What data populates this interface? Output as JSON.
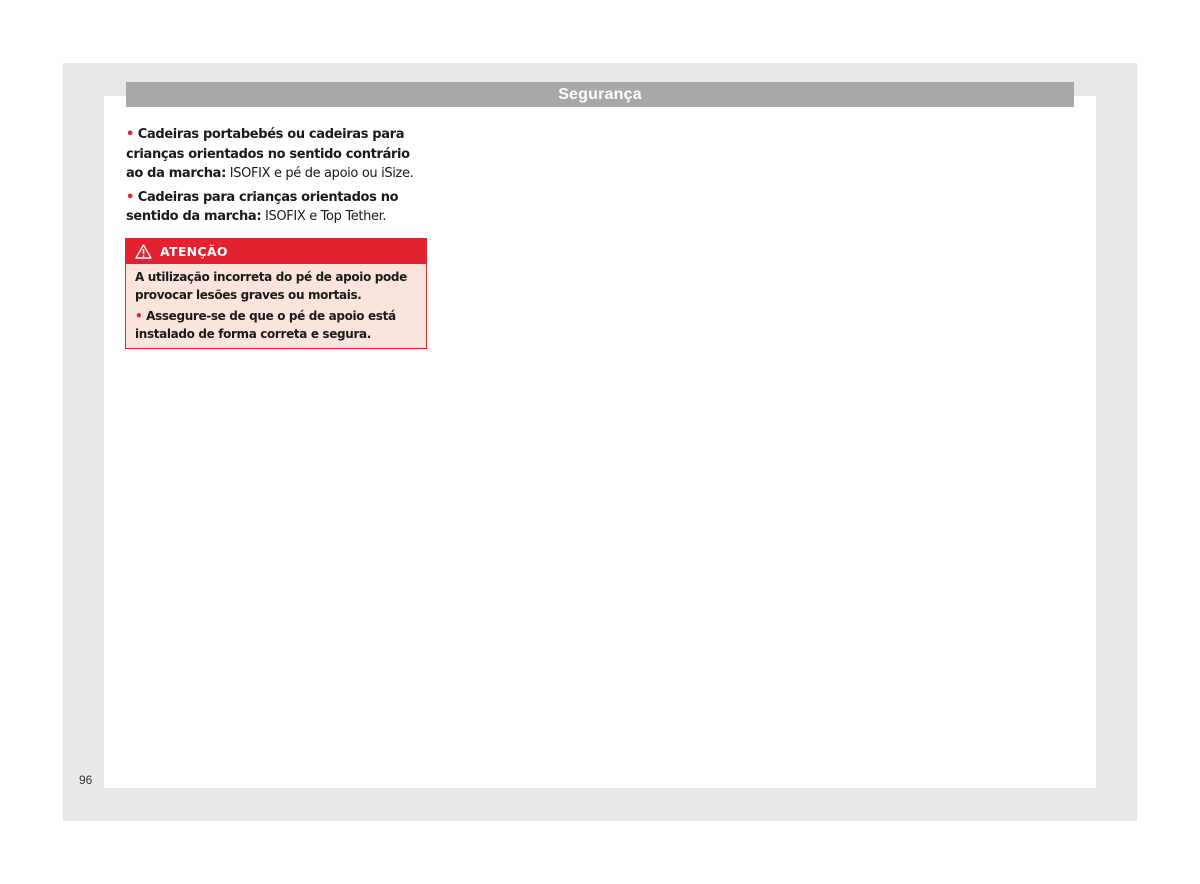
{
  "header": {
    "title": "Segurança"
  },
  "content": {
    "items": [
      {
        "bullet": "•",
        "bold": "Cadeiras portabebés ou cadeiras para cri­anças orientados no sentido contrário ao da marcha:",
        "text": " ISOFIX e pé de apoio ou iSize."
      },
      {
        "bullet": "•",
        "bold": "Cadeiras para crianças orientados no sen­tido da marcha:",
        "text": " ISOFIX e Top Tether."
      }
    ]
  },
  "warning": {
    "icon": "warning-triangle-icon",
    "title": "ATENÇÃO",
    "intro": "A utilização incorreta do pé de apoio pode provocar lesões graves ou mortais.",
    "bullet": "•",
    "item": "Assegure-se de que o pé de apoio está ins­talado de forma correta e segura."
  },
  "footer": {
    "page_number": "96"
  },
  "colors": {
    "accent": "#e2232f",
    "warning_background": "#fbe4dc",
    "header_bar": "#a8a8a8",
    "frame": "#e8e8e8"
  }
}
